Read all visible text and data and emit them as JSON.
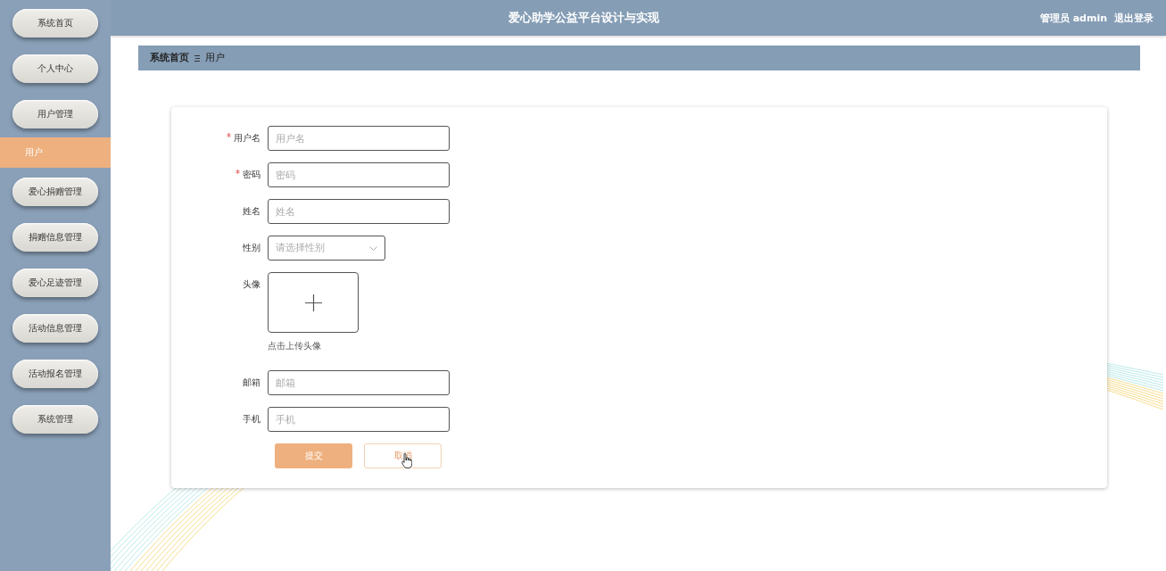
{
  "header": {
    "title": "爱心助学公益平台设计与实现",
    "user": "管理员 admin",
    "logout": "退出登录"
  },
  "sidebar": {
    "items": [
      {
        "label": "系统首页",
        "kind": "button",
        "selected": false
      },
      {
        "label": "个人中心",
        "kind": "button",
        "selected": false
      },
      {
        "label": "用户管理",
        "kind": "button",
        "selected": false
      },
      {
        "label": "用户",
        "kind": "subitem",
        "selected": true
      },
      {
        "label": "爱心捐赠管理",
        "kind": "button",
        "selected": false
      },
      {
        "label": "捐赠信息管理",
        "kind": "button",
        "selected": false
      },
      {
        "label": "爱心足迹管理",
        "kind": "button",
        "selected": false
      },
      {
        "label": "活动信息管理",
        "kind": "button",
        "selected": false
      },
      {
        "label": "活动报名管理",
        "kind": "button",
        "selected": false
      },
      {
        "label": "系统管理",
        "kind": "button",
        "selected": false
      }
    ]
  },
  "breadcrumb": [
    "系统首页",
    "用户"
  ],
  "form": {
    "fields": [
      {
        "label": "用户名",
        "kind": "text",
        "required": true,
        "placeholder": "用户名"
      },
      {
        "label": "密码",
        "kind": "text",
        "required": true,
        "placeholder": "密码"
      },
      {
        "label": "姓名",
        "kind": "text",
        "required": false,
        "placeholder": "姓名"
      },
      {
        "label": "性别",
        "kind": "select",
        "required": false,
        "placeholder": "请选择性别"
      },
      {
        "label": "头像",
        "kind": "upload",
        "required": false,
        "hint": "点击上传头像"
      },
      {
        "label": "邮箱",
        "kind": "text",
        "required": false,
        "placeholder": "邮箱"
      },
      {
        "label": "手机",
        "kind": "text",
        "required": false,
        "placeholder": "手机"
      }
    ],
    "buttons": [
      {
        "label": "提交",
        "kind": "primary"
      },
      {
        "label": "取消",
        "kind": "plain"
      }
    ]
  }
}
